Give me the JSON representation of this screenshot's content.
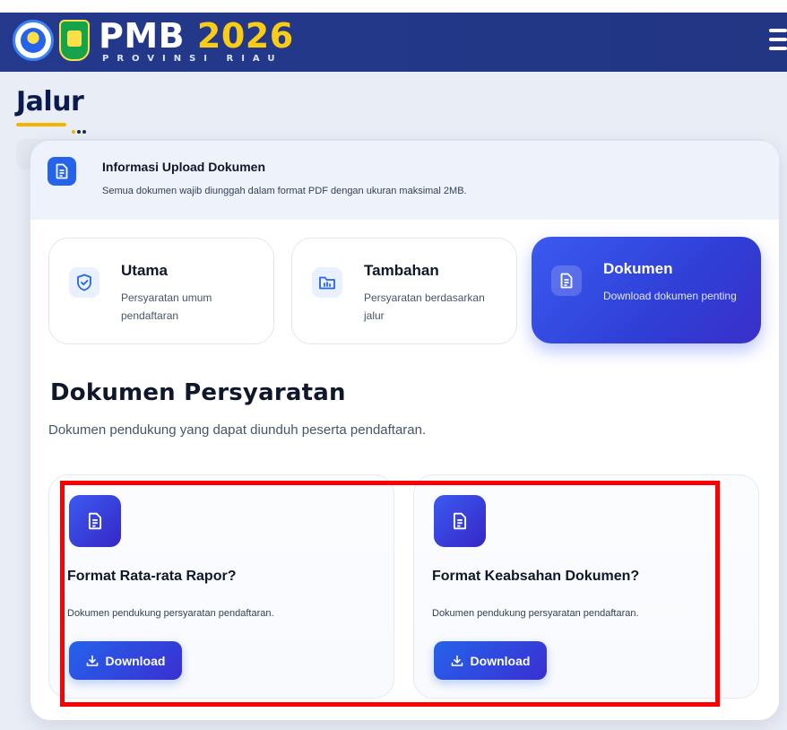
{
  "header": {
    "brand": "PMB",
    "year": "2026",
    "subtitle": "PROVINSI RIAU"
  },
  "page": {
    "title": "Jalur"
  },
  "info": {
    "title": "Informasi Upload Dokumen",
    "description": "Semua dokumen wajib diunggah dalam format PDF dengan ukuran maksimal 2MB.",
    "icon": "document-icon"
  },
  "tabs": [
    {
      "name": "Utama",
      "description": "Persyaratan umum pendaftaran",
      "icon": "shield-check-icon",
      "active": false
    },
    {
      "name": "Tambahan",
      "description": "Persyaratan berdasarkan jalur",
      "icon": "folder-icon",
      "active": false
    },
    {
      "name": "Dokumen",
      "description": "Download dokumen penting",
      "icon": "document-icon",
      "active": true
    }
  ],
  "section": {
    "title": "Dokumen Persyaratan",
    "description": "Dokumen pendukung yang dapat diunduh peserta pendaftaran."
  },
  "documents": [
    {
      "title": "Format Rata-rata Rapor?",
      "description": "Dokumen pendukung persyaratan pendaftaran.",
      "button": "Download"
    },
    {
      "title": "Format Keabsahan Dokumen?",
      "description": "Dokumen pendukung persyaratan pendaftaran.",
      "button": "Download"
    }
  ],
  "colors": {
    "header": "#24398c",
    "accent": "#2563eb",
    "highlight": "#ff0000"
  }
}
